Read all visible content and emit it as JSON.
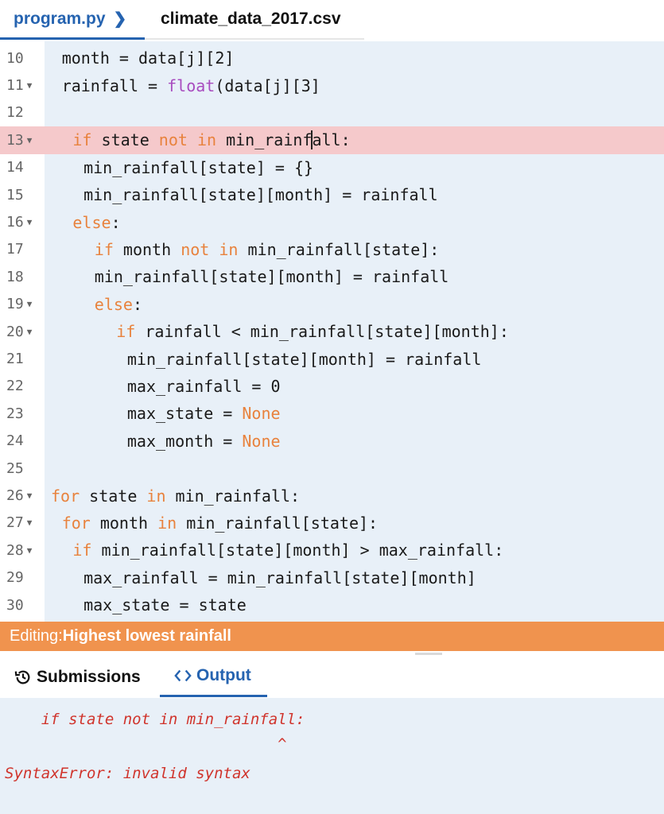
{
  "tabs": [
    {
      "label": "program.py",
      "active": true
    },
    {
      "label": "climate_data_2017.csv",
      "active": false
    }
  ],
  "tab_chevron": "❯",
  "editor": {
    "lines": [
      {
        "num": "10",
        "fold": false,
        "indent": 3,
        "tokens": [
          [
            "month = data[j][2]",
            ""
          ]
        ]
      },
      {
        "num": "11",
        "fold": true,
        "indent": 3,
        "tokens": [
          [
            "rainfall = ",
            ""
          ],
          [
            "float",
            "fn"
          ],
          [
            "(data[j][3]",
            ""
          ]
        ]
      },
      {
        "num": "12",
        "fold": false,
        "indent": 0,
        "tokens": []
      },
      {
        "num": "13",
        "fold": true,
        "indent": 5,
        "hl": true,
        "tokens": [
          [
            "if",
            "kw"
          ],
          [
            " state ",
            ""
          ],
          [
            "not",
            "kw"
          ],
          [
            " ",
            ""
          ],
          [
            "in",
            "kw"
          ],
          [
            " min_rainf",
            ""
          ],
          [
            "|",
            "cursor"
          ],
          [
            "all:",
            ""
          ]
        ]
      },
      {
        "num": "14",
        "fold": false,
        "indent": 7,
        "tokens": [
          [
            "min_rainfall[state] = {}",
            ""
          ]
        ]
      },
      {
        "num": "15",
        "fold": false,
        "indent": 7,
        "tokens": [
          [
            "min_rainfall[state][month] = rainfall",
            ""
          ]
        ]
      },
      {
        "num": "16",
        "fold": true,
        "indent": 5,
        "tokens": [
          [
            "else",
            "kw"
          ],
          [
            ":",
            ""
          ]
        ]
      },
      {
        "num": "17",
        "fold": false,
        "indent": 9,
        "tokens": [
          [
            "if",
            "kw"
          ],
          [
            " month ",
            ""
          ],
          [
            "not",
            "kw"
          ],
          [
            " ",
            ""
          ],
          [
            "in",
            "kw"
          ],
          [
            " min_rainfall[state]:",
            ""
          ]
        ]
      },
      {
        "num": "18",
        "fold": false,
        "indent": 9,
        "tokens": [
          [
            "min_rainfall[state][month] = rainfall",
            ""
          ]
        ]
      },
      {
        "num": "19",
        "fold": true,
        "indent": 9,
        "tokens": [
          [
            "else",
            "kw"
          ],
          [
            ":",
            ""
          ]
        ]
      },
      {
        "num": "20",
        "fold": true,
        "indent": 13,
        "tokens": [
          [
            "if",
            "kw"
          ],
          [
            " rainfall < min_rainfall[state][month]:",
            ""
          ]
        ]
      },
      {
        "num": "21",
        "fold": false,
        "indent": 15,
        "tokens": [
          [
            "min_rainfall[state][month] = rainfall",
            ""
          ]
        ]
      },
      {
        "num": "22",
        "fold": false,
        "indent": 15,
        "tokens": [
          [
            "max_rainfall = 0",
            ""
          ]
        ]
      },
      {
        "num": "23",
        "fold": false,
        "indent": 15,
        "tokens": [
          [
            "max_state = ",
            ""
          ],
          [
            "None",
            "kw"
          ]
        ]
      },
      {
        "num": "24",
        "fold": false,
        "indent": 15,
        "tokens": [
          [
            "max_month = ",
            ""
          ],
          [
            "None",
            "kw"
          ]
        ]
      },
      {
        "num": "25",
        "fold": false,
        "indent": 0,
        "tokens": []
      },
      {
        "num": "26",
        "fold": true,
        "indent": 1,
        "tokens": [
          [
            "for",
            "kw"
          ],
          [
            " state ",
            ""
          ],
          [
            "in",
            "kw"
          ],
          [
            " min_rainfall:",
            ""
          ]
        ]
      },
      {
        "num": "27",
        "fold": true,
        "indent": 3,
        "tokens": [
          [
            "for",
            "kw"
          ],
          [
            " month ",
            ""
          ],
          [
            "in",
            "kw"
          ],
          [
            " min_rainfall[state]:",
            ""
          ]
        ]
      },
      {
        "num": "28",
        "fold": true,
        "indent": 5,
        "tokens": [
          [
            "if",
            "kw"
          ],
          [
            " min_rainfall[state][month] > max_rainfall:",
            ""
          ]
        ]
      },
      {
        "num": "29",
        "fold": false,
        "indent": 7,
        "tokens": [
          [
            "max_rainfall = min_rainfall[state][month]",
            ""
          ]
        ]
      },
      {
        "num": "30",
        "fold": false,
        "indent": 7,
        "tokens": [
          [
            "max_state = state",
            ""
          ]
        ]
      }
    ]
  },
  "status": {
    "prefix": "Editing: ",
    "title": "Highest lowest rainfall"
  },
  "bottom_tabs": [
    {
      "label": "Submissions",
      "icon": "history-icon"
    },
    {
      "label": "Output",
      "icon": "code-icon",
      "active": true
    }
  ],
  "output": {
    "lines": [
      "    if state not in min_rainfall:",
      "                              ^",
      "SyntaxError: invalid syntax"
    ]
  },
  "colors": {
    "accent": "#2563b0",
    "keyword": "#e8823d",
    "builtin": "#a84cbf",
    "highlight_line": "#f5c9cb",
    "status_bar": "#f0934e",
    "error_text": "#d0342c",
    "editor_bg": "#e8f0f8"
  }
}
